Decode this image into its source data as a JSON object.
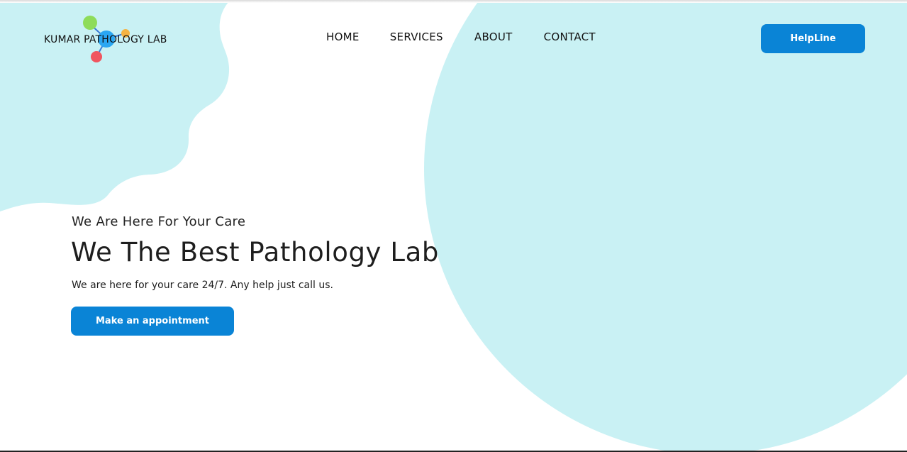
{
  "brand": {
    "name": "KUMAR PATHOLOGY LAB",
    "logo_icon": "molecule-icon",
    "logo_colors": [
      "#8edc5a",
      "#2aa6f2",
      "#f5b342",
      "#f0555f",
      "#3a7bd5"
    ]
  },
  "nav": {
    "items": [
      {
        "label": "HOME"
      },
      {
        "label": "SERVICES"
      },
      {
        "label": "ABOUT"
      },
      {
        "label": "CONTACT"
      }
    ]
  },
  "header": {
    "helpline_label": "HelpLine"
  },
  "hero": {
    "eyebrow": "We Are Here For Your Care",
    "title": "We The Best Pathology Lab",
    "description": "We are here for your care 24/7. Any help just call us.",
    "cta_label": "Make an appointment"
  },
  "theme": {
    "accent": "#0a84d6",
    "blob": "#c9f1f4",
    "text": "#1e1e1e"
  }
}
